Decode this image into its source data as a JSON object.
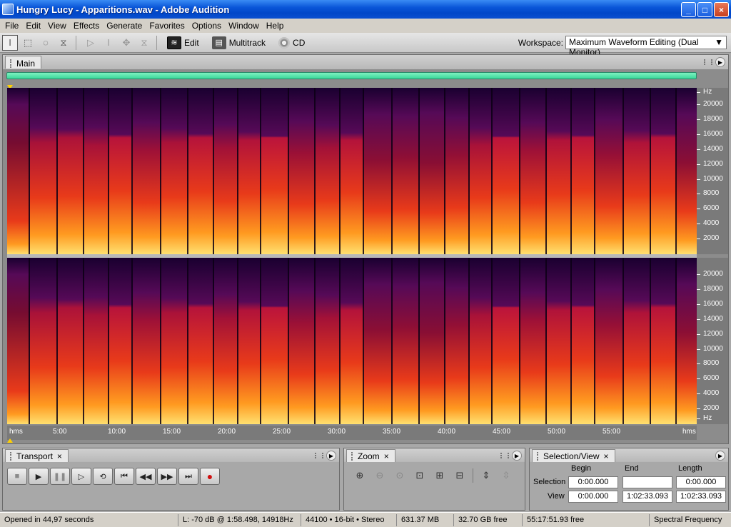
{
  "window": {
    "title": "Hungry Lucy - Apparitions.wav - Adobe Audition",
    "controls": [
      "_",
      "□",
      "×"
    ]
  },
  "menu": [
    "File",
    "Edit",
    "View",
    "Effects",
    "Generate",
    "Favorites",
    "Options",
    "Window",
    "Help"
  ],
  "toolbar": {
    "modes": [
      {
        "label": "Edit",
        "icon": "edit-waveform-icon",
        "active": true
      },
      {
        "label": "Multitrack",
        "icon": "multitrack-icon",
        "active": false
      },
      {
        "label": "CD",
        "icon": "cd-icon",
        "active": false
      }
    ],
    "workspace_label": "Workspace:",
    "workspace_value": "Maximum Waveform Editing (Dual Monitor)"
  },
  "main_panel": {
    "tab": "Main",
    "freq_unit": "Hz",
    "freq_ticks": [
      "20000",
      "18000",
      "16000",
      "14000",
      "12000",
      "10000",
      "8000",
      "6000",
      "4000",
      "2000"
    ],
    "freq_bottom_label": "Hz",
    "time_ticks": [
      "hms",
      "5:00",
      "10:00",
      "15:00",
      "20:00",
      "25:00",
      "30:00",
      "35:00",
      "40:00",
      "45:00",
      "50:00",
      "55:00",
      "hms"
    ]
  },
  "transport": {
    "tab": "Transport",
    "close": "×",
    "buttons": [
      "stop",
      "play",
      "pause",
      "play-from-cursor",
      "loop",
      "go-to-start",
      "rewind",
      "fast-forward",
      "go-to-end",
      "record"
    ]
  },
  "zoom": {
    "tab": "Zoom",
    "close": "×"
  },
  "selection_view": {
    "tab": "Selection/View",
    "close": "×",
    "headers": [
      "Begin",
      "End",
      "Length"
    ],
    "selection_label": "Selection",
    "selection": {
      "begin": "0:00.000",
      "end": "",
      "length": "0:00.000"
    },
    "view_label": "View",
    "view": {
      "begin": "0:00.000",
      "end": "1:02:33.093",
      "length": "1:02:33.093"
    }
  },
  "status": {
    "opened": "Opened in 44,97 seconds",
    "cursor": "L: -70 dB @  1:58.498, 14918Hz",
    "format": "44100 • 16-bit • Stereo",
    "size": "631.37 MB",
    "free": "32.70 GB free",
    "time_free": "55:17:51.93 free",
    "view_mode": "Spectral Frequency"
  },
  "colors": {
    "overview": "#3ad89a",
    "playhead": "#ffd000",
    "spectrogram_low": "#1a0030",
    "spectrogram_high": "#ffe080"
  }
}
